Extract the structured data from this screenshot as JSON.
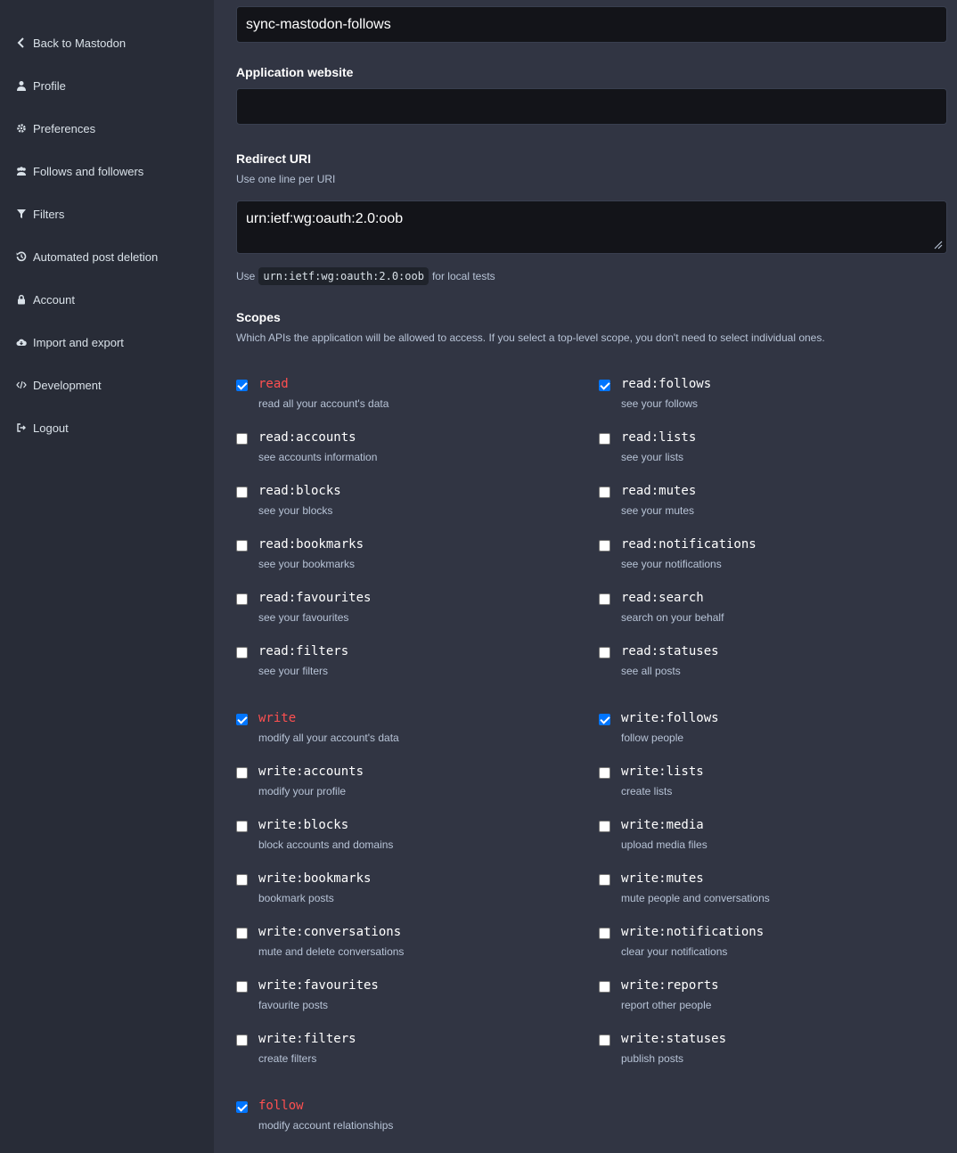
{
  "sidebar": {
    "items": [
      {
        "label": "Back to Mastodon",
        "icon": "chevron-left-icon"
      },
      {
        "label": "Profile",
        "icon": "user-icon"
      },
      {
        "label": "Preferences",
        "icon": "gear-icon"
      },
      {
        "label": "Follows and followers",
        "icon": "users-icon"
      },
      {
        "label": "Filters",
        "icon": "filter-icon"
      },
      {
        "label": "Automated post deletion",
        "icon": "history-icon"
      },
      {
        "label": "Account",
        "icon": "lock-icon"
      },
      {
        "label": "Import and export",
        "icon": "cloud-icon"
      },
      {
        "label": "Development",
        "icon": "code-icon"
      },
      {
        "label": "Logout",
        "icon": "sign-out-icon"
      }
    ]
  },
  "form": {
    "app_name_value": "sync-mastodon-follows",
    "website_label": "Application website",
    "website_value": "",
    "redirect_label": "Redirect URI",
    "redirect_hint": "Use one line per URI",
    "redirect_value": "urn:ietf:wg:oauth:2.0:oob",
    "local_hint_prefix": "Use",
    "local_hint_code": "urn:ietf:wg:oauth:2.0:oob",
    "local_hint_suffix": "for local tests",
    "scopes_label": "Scopes",
    "scopes_hint": "Which APIs the application will be allowed to access. If you select a top-level scope, you don't need to select individual ones."
  },
  "scopes": [
    {
      "name": "read",
      "desc": "read all your account's data",
      "checked": true,
      "top": true
    },
    {
      "name": "read:follows",
      "desc": "see your follows",
      "checked": true
    },
    {
      "name": "read:accounts",
      "desc": "see accounts information",
      "checked": false
    },
    {
      "name": "read:lists",
      "desc": "see your lists",
      "checked": false
    },
    {
      "name": "read:blocks",
      "desc": "see your blocks",
      "checked": false
    },
    {
      "name": "read:mutes",
      "desc": "see your mutes",
      "checked": false
    },
    {
      "name": "read:bookmarks",
      "desc": "see your bookmarks",
      "checked": false
    },
    {
      "name": "read:notifications",
      "desc": "see your notifications",
      "checked": false
    },
    {
      "name": "read:favourites",
      "desc": "see your favourites",
      "checked": false
    },
    {
      "name": "read:search",
      "desc": "search on your behalf",
      "checked": false
    },
    {
      "name": "read:filters",
      "desc": "see your filters",
      "checked": false
    },
    {
      "name": "read:statuses",
      "desc": "see all posts",
      "checked": false
    },
    {
      "name": "write",
      "desc": "modify all your account's data",
      "checked": true,
      "top": true
    },
    {
      "name": "write:follows",
      "desc": "follow people",
      "checked": true
    },
    {
      "name": "write:accounts",
      "desc": "modify your profile",
      "checked": false
    },
    {
      "name": "write:lists",
      "desc": "create lists",
      "checked": false
    },
    {
      "name": "write:blocks",
      "desc": "block accounts and domains",
      "checked": false
    },
    {
      "name": "write:media",
      "desc": "upload media files",
      "checked": false
    },
    {
      "name": "write:bookmarks",
      "desc": "bookmark posts",
      "checked": false
    },
    {
      "name": "write:mutes",
      "desc": "mute people and conversations",
      "checked": false
    },
    {
      "name": "write:conversations",
      "desc": "mute and delete conversations",
      "checked": false
    },
    {
      "name": "write:notifications",
      "desc": "clear your notifications",
      "checked": false
    },
    {
      "name": "write:favourites",
      "desc": "favourite posts",
      "checked": false
    },
    {
      "name": "write:reports",
      "desc": "report other people",
      "checked": false
    },
    {
      "name": "write:filters",
      "desc": "create filters",
      "checked": false
    },
    {
      "name": "write:statuses",
      "desc": "publish posts",
      "checked": false
    },
    {
      "name": "follow",
      "desc": "modify account relationships",
      "checked": true,
      "top": true
    }
  ]
}
